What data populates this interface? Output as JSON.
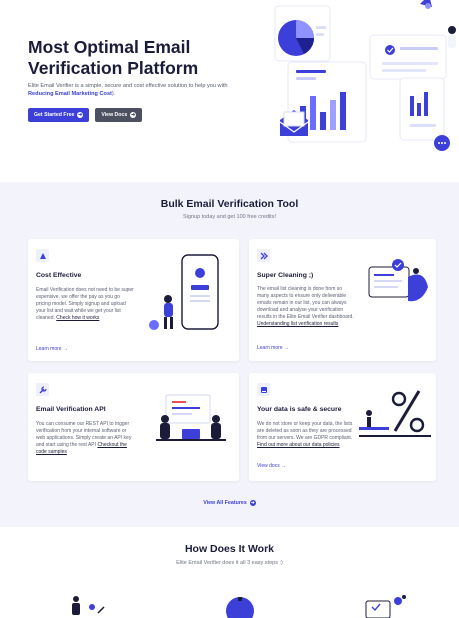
{
  "hero": {
    "title": "Most Optimal Email Verification Platform",
    "desc_prefix": "Elite Email Verifier is a simple, secure and cost effective solution to help you with ",
    "desc_highlight": "Reducing Email Marketing Cost",
    "desc_suffix": ").",
    "primary_button": "Get Started Free",
    "secondary_button": "View Docs",
    "arrow_glyph": "➔"
  },
  "features": {
    "title": "Bulk Email Verification Tool",
    "subtitle": "Signup today and get 100 free credits!",
    "cards": [
      {
        "icon": "tag-icon",
        "title": "Cost Effective",
        "body": "Email Verification does not need to be super expensive, we offer the pay as you go pricing model. Simply signup and upload your list and wait while we get your list cleaned. ",
        "link": "Check how it works",
        "more": "Learn more →"
      },
      {
        "icon": "double-chevron-icon",
        "title": "Super Cleaning ;)",
        "body": "The email list cleaning is done from so many aspects to ensure only deliverable emails remain in our list, you can always download and analyse your verification results in the Elite Email Verifier dashboard. ",
        "link": "Understanding list verification results",
        "more": "Learn more →"
      },
      {
        "icon": "wrench-icon",
        "title": "Email Verification API",
        "body": "You can consume our REST API to trigger verification from your internal software or web applications. Simply create an API key and start using the rest API ",
        "link": "Checkout the code samples",
        "more": "Learn more →"
      },
      {
        "icon": "storage-icon",
        "title": "Your data is safe & secure",
        "body": "We do not store or keep your data, the lists are deleted as soon as they are processed from our servers. We are GDPR compliant. ",
        "link": "Find out more about our data policies",
        "more": "View docs →"
      }
    ],
    "view_all": "View All Features",
    "arrow_glyph": "➔"
  },
  "how": {
    "title": "How Does It Work",
    "subtitle": "Elite Email Verifier does it all 3 easy steps :)"
  },
  "colors": {
    "accent": "#3d40d8",
    "dark_button": "#4d5060",
    "section_bg": "#f3f4fb",
    "heading": "#1b1b3a"
  }
}
